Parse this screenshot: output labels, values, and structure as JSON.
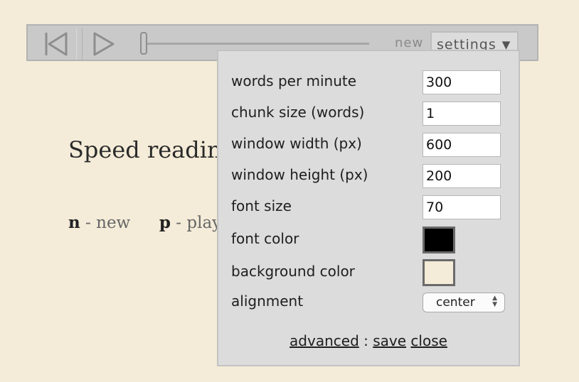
{
  "page": {
    "title": "Speed readin",
    "shortcuts": [
      {
        "key": "n",
        "action": "- new"
      },
      {
        "key": "p",
        "action": "- play"
      }
    ]
  },
  "toolbar": {
    "prev_icon": "skip-back-icon",
    "play_icon": "play-icon",
    "new_label": "new",
    "settings_label": "settings",
    "settings_arrow": "▼"
  },
  "settings": {
    "rows": [
      {
        "label": "words per minute",
        "value": "300"
      },
      {
        "label": "chunk size (words)",
        "value": "1"
      },
      {
        "label": "window width (px)",
        "value": "600"
      },
      {
        "label": "window height (px)",
        "value": "200"
      },
      {
        "label": "font size",
        "value": "70"
      }
    ],
    "font_color": {
      "label": "font color",
      "value": "#000000"
    },
    "background_color": {
      "label": "background color",
      "value": "#f4ecd8"
    },
    "alignment": {
      "label": "alignment",
      "value": "center"
    },
    "advanced_label": "advanced",
    "separator": ":",
    "save_label": "save",
    "close_label": "close"
  },
  "colors": {
    "page_background": "#f4ecd8",
    "toolbar": "#c9c9c9",
    "panel": "#dcdcdc"
  }
}
